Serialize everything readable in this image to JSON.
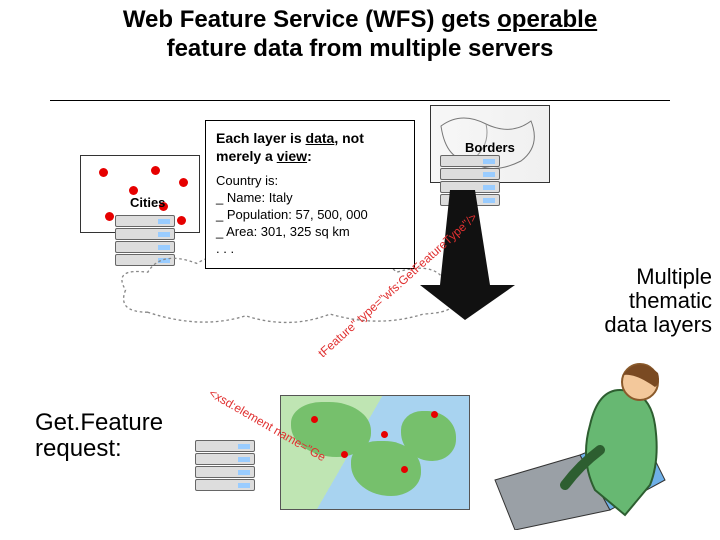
{
  "title": {
    "line1_prefix": "Web Feature Service (WFS) gets ",
    "line1_underlined": "operable",
    "line2": "feature data from multiple servers"
  },
  "layers": {
    "cities_label": "Cities",
    "borders_label": "Borders"
  },
  "infobox": {
    "header_prefix": "Each layer is ",
    "header_underlined": "data",
    "header_mid": ", not merely a ",
    "header_underlined2": "view",
    "header_suffix": ":",
    "country_heading": "Country is:",
    "rows": [
      "_ Name: Italy",
      "_ Population: 57, 500, 000",
      "_ Area: 301, 325 sq km",
      ". . ."
    ]
  },
  "right_caption": {
    "line1": "Multiple",
    "line2": "thematic",
    "line3": "data layers"
  },
  "getfeature": {
    "line1": "Get.Feature",
    "line2": "request:"
  },
  "xml_snippet": {
    "part1": "<xsd:element name=\"Ge",
    "part2": "tFeature\" type=\"wfs:GetFeatureType\"/>"
  },
  "icons": {
    "server": "server-stack",
    "cloud": "cloud",
    "person": "user-at-laptop",
    "arrow": "down-arrow"
  }
}
